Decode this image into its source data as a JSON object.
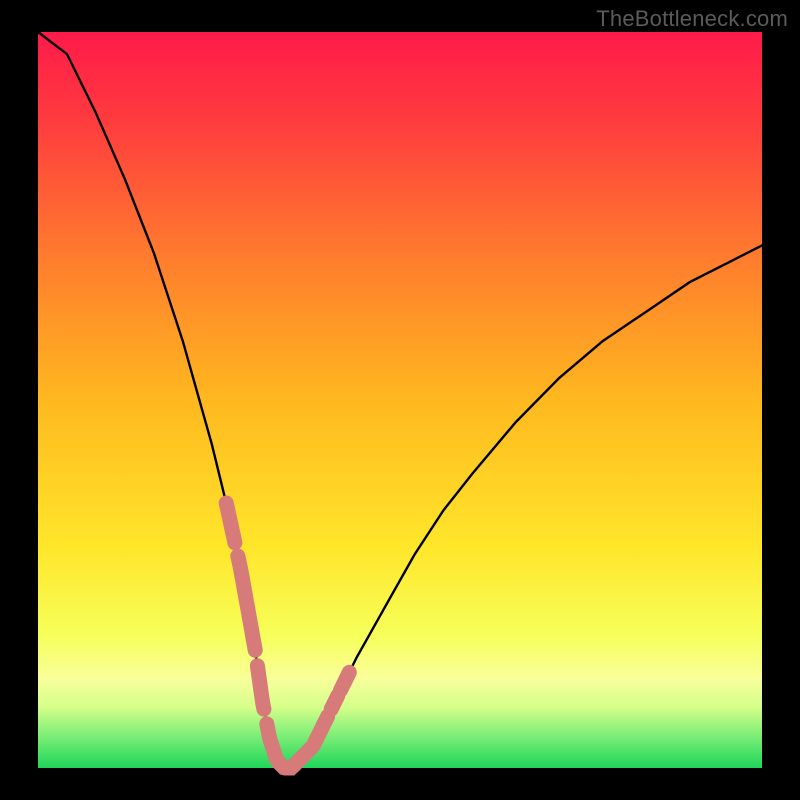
{
  "watermark": "TheBottleneck.com",
  "colors": {
    "black": "#000000",
    "curve": "#000000",
    "marker": "#d67a7a",
    "green": "#1fd65a",
    "gradient_top": "#ff1a4a",
    "gradient_mid": "#ffd800",
    "gradient_bottom": "#f8ff6a"
  },
  "chart_data": {
    "type": "line",
    "title": "",
    "xlabel": "",
    "ylabel": "",
    "xlim": [
      0,
      100
    ],
    "ylim": [
      0,
      100
    ],
    "x": [
      0,
      4,
      8,
      12,
      16,
      20,
      24,
      26,
      28,
      30,
      31,
      32,
      33,
      34,
      35,
      36,
      38,
      40,
      44,
      48,
      52,
      56,
      60,
      66,
      72,
      78,
      84,
      90,
      96,
      100
    ],
    "values": [
      104,
      97,
      89,
      80,
      70,
      58,
      44,
      36,
      27,
      16,
      9,
      4,
      1,
      0,
      0,
      1,
      3,
      7,
      15,
      22,
      29,
      35,
      40,
      47,
      53,
      58,
      62,
      66,
      69,
      71
    ],
    "minimum": {
      "x": 34,
      "y": 0
    },
    "marker_segments_x": [
      [
        26.0,
        27.2
      ],
      [
        27.6,
        30.0
      ],
      [
        30.3,
        31.2
      ],
      [
        31.6,
        37.0
      ],
      [
        37.3,
        40.0
      ],
      [
        40.5,
        41.4
      ],
      [
        41.8,
        43.0
      ]
    ],
    "annotations": []
  }
}
